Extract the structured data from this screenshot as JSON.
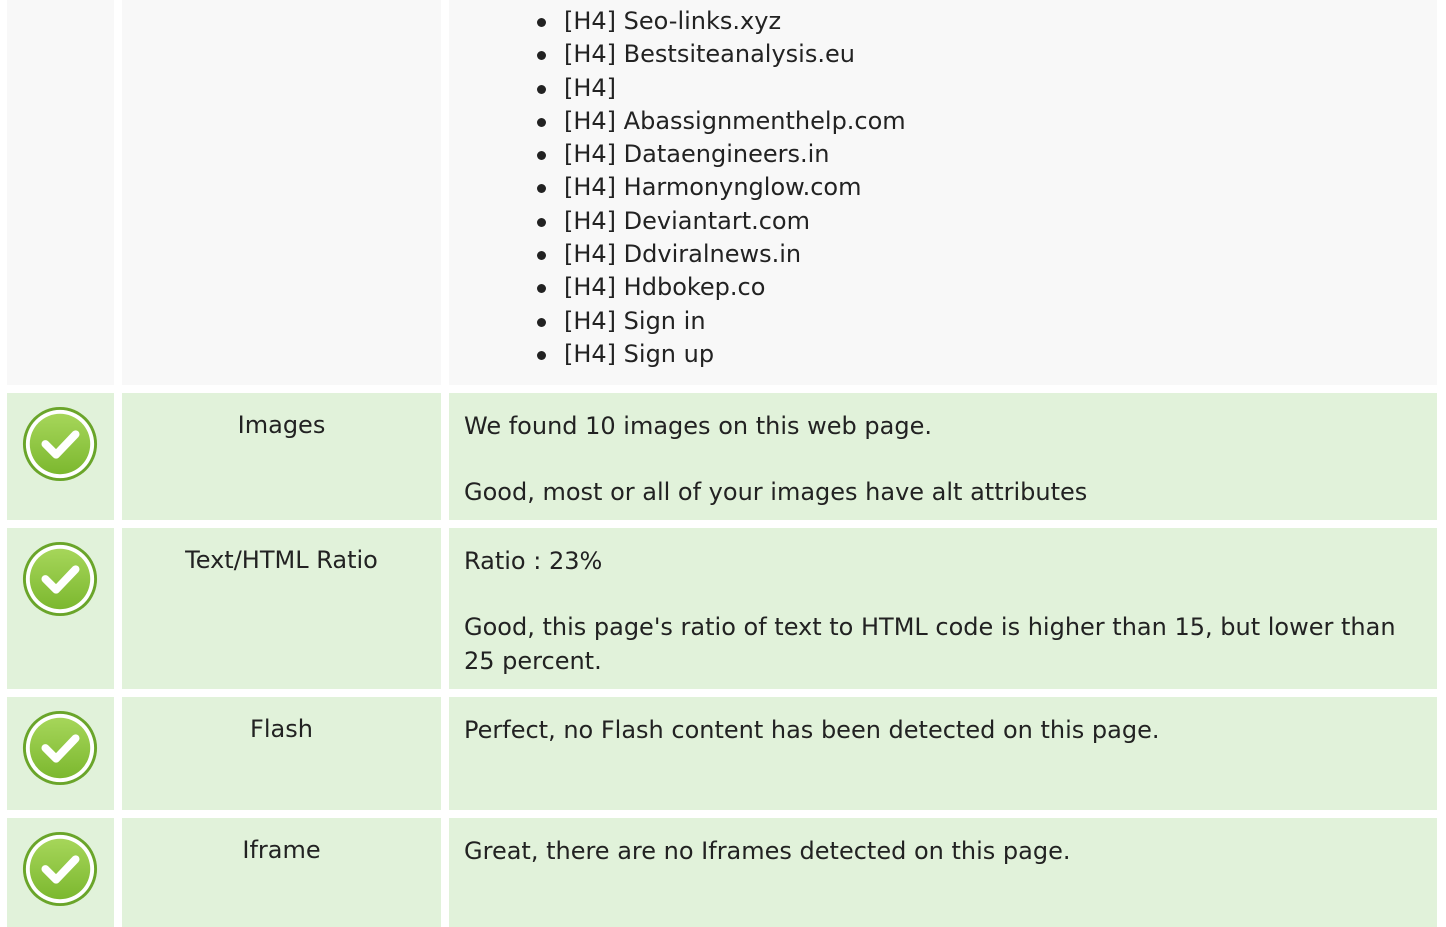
{
  "headings": {
    "items": [
      "[H4] Seo-links.xyz",
      "[H4] Bestsiteanalysis.eu",
      "[H4]",
      "[H4] Abassignmenthelp.com",
      "[H4] Dataengineers.in",
      "[H4] Harmonynglow.com",
      "[H4] Deviantart.com",
      "[H4] Ddviralnews.in",
      "[H4] Hdbokep.co",
      "[H4] Sign in",
      "[H4] Sign up"
    ]
  },
  "checks": [
    {
      "name": "Images",
      "status": "pass",
      "icon": "check-circle-icon",
      "lines": [
        "We found 10 images on this web page.",
        "Good, most or all of your images have alt attributes"
      ]
    },
    {
      "name": "Text/HTML Ratio",
      "status": "pass",
      "icon": "check-circle-icon",
      "lines": [
        "Ratio : 23%",
        "Good, this page's ratio of text to HTML code is higher than 15, but lower than 25 percent."
      ]
    },
    {
      "name": "Flash",
      "status": "pass",
      "icon": "check-circle-icon",
      "lines": [
        "Perfect, no Flash content has been detected on this page."
      ]
    },
    {
      "name": "Iframe",
      "status": "pass",
      "icon": "check-circle-icon",
      "lines": [
        "Great, there are no Iframes detected on this page."
      ]
    }
  ],
  "colors": {
    "pass_bg": "#e1f2da",
    "neutral_bg": "#f8f8f8",
    "check_green": "#8dc63f",
    "text": "#222222"
  }
}
